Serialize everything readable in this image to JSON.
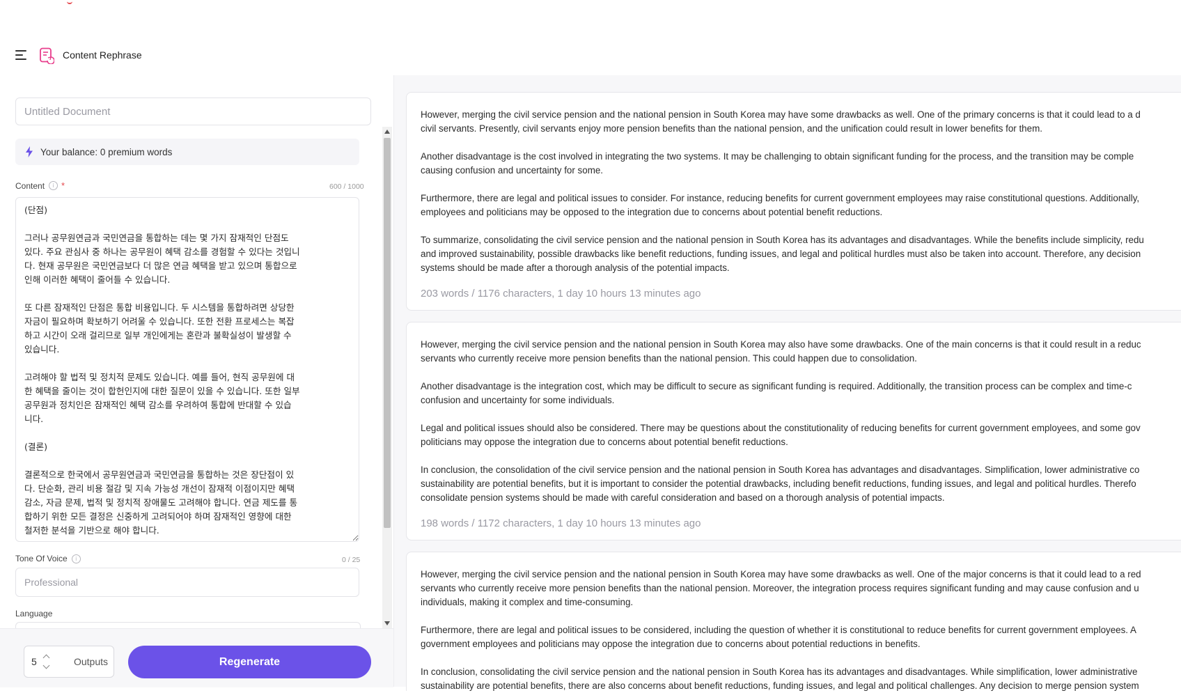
{
  "header": {
    "title": "Content Rephrase"
  },
  "document": {
    "title_placeholder": "Untitled Document"
  },
  "balance": {
    "text": "Your balance: 0 premium words"
  },
  "content": {
    "label": "Content",
    "required_mark": "*",
    "counter": "600 / 1000",
    "text": "(단점)\n\n그러나 공무원연금과 국민연금을 통합하는 데는 몇 가지 잠재적인 단점도\n있다. 주요 관심사 중 하나는 공무원이 혜택 감소를 경험할 수 있다는 것입니\n다. 현재 공무원은 국민연금보다 더 많은 연금 혜택을 받고 있으며 통합으로\n인해 이러한 혜택이 줄어들 수 있습니다.\n\n또 다른 잠재적인 단점은 통합 비용입니다. 두 시스템을 통합하려면 상당한\n자금이 필요하며 확보하기 어려울 수 있습니다. 또한 전환 프로세스는 복잡\n하고 시간이 오래 걸리므로 일부 개인에게는 혼란과 불확실성이 발생할 수\n있습니다.\n\n고려해야 할 법적 및 정치적 문제도 있습니다. 예를 들어, 현직 공무원에 대\n한 혜택을 줄이는 것이 합헌인지에 대한 질문이 있을 수 있습니다. 또한 일부\n공무원과 정치인은 잠재적인 혜택 감소를 우려하여 통합에 반대할 수 있습\n니다.\n\n(결론)\n\n결론적으로 한국에서 공무원연금과 국민연금을 통합하는 것은 장단점이 있\n다. 단순화, 관리 비용 절감 및 지속 가능성 개선이 잠재적 이점이지만 혜택\n감소, 자금 문제, 법적 및 정치적 장애물도 고려해야 합니다. 연금 제도를 통\n합하기 위한 모든 결정은 신중하게 고려되어야 하며 잠재적인 영향에 대한\n철저한 분석을 기반으로 해야 합니다."
  },
  "tone": {
    "label": "Tone Of Voice",
    "counter": "0 / 25",
    "placeholder": "Professional"
  },
  "language": {
    "label": "Language"
  },
  "footer": {
    "outputs_value": "5",
    "outputs_label": "Outputs",
    "regenerate_label": "Regenerate"
  },
  "results": [
    {
      "paragraphs": [
        [
          "However, merging the civil service pension and the national pension in South Korea may have some drawbacks as well. One of the primary concerns is that it could lead to a d",
          "civil servants. Presently, civil servants enjoy more pension benefits than the national pension, and the unification could result in lower benefits for them."
        ],
        [
          "Another disadvantage is the cost involved in integrating the two systems. It may be challenging to obtain significant funding for the process, and the transition may be comple",
          "causing confusion and uncertainty for some."
        ],
        [
          "Furthermore, there are legal and political issues to consider. For instance, reducing benefits for current government employees may raise constitutional questions. Additionally,",
          "employees and politicians may be opposed to the integration due to concerns about potential benefit reductions."
        ],
        [
          "To summarize, consolidating the civil service pension and the national pension in South Korea has its advantages and disadvantages. While the benefits include simplicity, redu",
          "and improved sustainability, possible drawbacks like benefit reductions, funding issues, and legal and political hurdles must also be taken into account. Therefore, any decision",
          "systems should be made after a thorough analysis of the potential impacts."
        ]
      ],
      "meta": "203 words / 1176 characters, 1 day 10 hours 13 minutes ago"
    },
    {
      "paragraphs": [
        [
          "However, merging the civil service pension and the national pension in South Korea may also have some drawbacks. One of the main concerns is that it could result in a reduc",
          "servants who currently receive more pension benefits than the national pension. This could happen due to consolidation."
        ],
        [
          "Another disadvantage is the integration cost, which may be difficult to secure as significant funding is required. Additionally, the transition process can be complex and time-c",
          "confusion and uncertainty for some individuals."
        ],
        [
          "Legal and political issues should also be considered. There may be questions about the constitutionality of reducing benefits for current government employees, and some gov",
          "politicians may oppose the integration due to concerns about potential benefit reductions."
        ],
        [
          "In conclusion, the consolidation of the civil service pension and the national pension in South Korea has advantages and disadvantages. Simplification, lower administrative co",
          "sustainability are potential benefits, but it is important to consider the potential drawbacks, including benefit reductions, funding issues, and legal and political hurdles. Therefo",
          "consolidate pension systems should be made with careful consideration and based on a thorough analysis of potential impacts."
        ]
      ],
      "meta": "198 words / 1172 characters, 1 day 10 hours 13 minutes ago"
    },
    {
      "paragraphs": [
        [
          "However, merging the civil service pension and the national pension in South Korea may have some drawbacks as well. One of the major concerns is that it could lead to a red",
          "servants who currently receive more pension benefits than the national pension. Moreover, the integration process requires significant funding and may cause confusion and u",
          "individuals, making it complex and time-consuming."
        ],
        [
          "Furthermore, there are legal and political issues to be considered, including the question of whether it is constitutional to reduce benefits for current government employees. A",
          "government employees and politicians may oppose the integration due to concerns about potential reductions in benefits."
        ],
        [
          "In conclusion, consolidating the civil service pension and the national pension in South Korea has its advantages and disadvantages. While simplification, lower administrative",
          "sustainability are potential benefits, there are also concerns about benefit reductions, funding issues, and legal and political challenges. Any decision to merge pension system"
        ]
      ],
      "meta": ""
    }
  ]
}
